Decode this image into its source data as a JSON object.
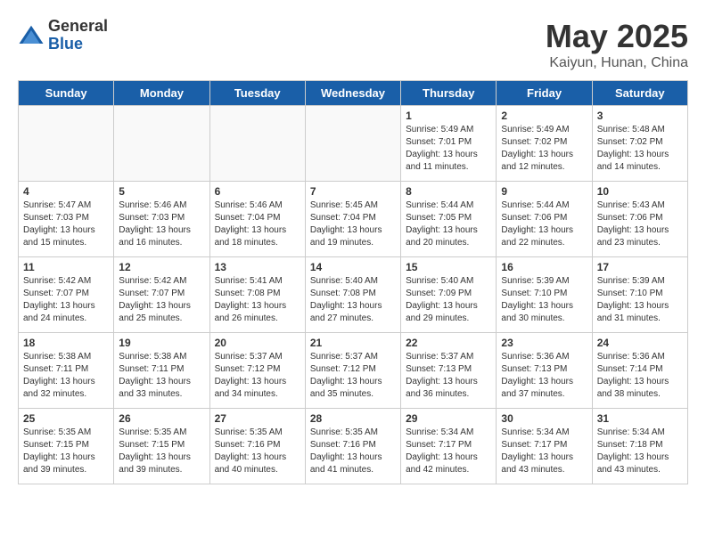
{
  "logo": {
    "general": "General",
    "blue": "Blue"
  },
  "title": "May 2025",
  "subtitle": "Kaiyun, Hunan, China",
  "weekdays": [
    "Sunday",
    "Monday",
    "Tuesday",
    "Wednesday",
    "Thursday",
    "Friday",
    "Saturday"
  ],
  "weeks": [
    [
      {
        "day": "",
        "info": ""
      },
      {
        "day": "",
        "info": ""
      },
      {
        "day": "",
        "info": ""
      },
      {
        "day": "",
        "info": ""
      },
      {
        "day": "1",
        "info": "Sunrise: 5:49 AM\nSunset: 7:01 PM\nDaylight: 13 hours\nand 11 minutes."
      },
      {
        "day": "2",
        "info": "Sunrise: 5:49 AM\nSunset: 7:02 PM\nDaylight: 13 hours\nand 12 minutes."
      },
      {
        "day": "3",
        "info": "Sunrise: 5:48 AM\nSunset: 7:02 PM\nDaylight: 13 hours\nand 14 minutes."
      }
    ],
    [
      {
        "day": "4",
        "info": "Sunrise: 5:47 AM\nSunset: 7:03 PM\nDaylight: 13 hours\nand 15 minutes."
      },
      {
        "day": "5",
        "info": "Sunrise: 5:46 AM\nSunset: 7:03 PM\nDaylight: 13 hours\nand 16 minutes."
      },
      {
        "day": "6",
        "info": "Sunrise: 5:46 AM\nSunset: 7:04 PM\nDaylight: 13 hours\nand 18 minutes."
      },
      {
        "day": "7",
        "info": "Sunrise: 5:45 AM\nSunset: 7:04 PM\nDaylight: 13 hours\nand 19 minutes."
      },
      {
        "day": "8",
        "info": "Sunrise: 5:44 AM\nSunset: 7:05 PM\nDaylight: 13 hours\nand 20 minutes."
      },
      {
        "day": "9",
        "info": "Sunrise: 5:44 AM\nSunset: 7:06 PM\nDaylight: 13 hours\nand 22 minutes."
      },
      {
        "day": "10",
        "info": "Sunrise: 5:43 AM\nSunset: 7:06 PM\nDaylight: 13 hours\nand 23 minutes."
      }
    ],
    [
      {
        "day": "11",
        "info": "Sunrise: 5:42 AM\nSunset: 7:07 PM\nDaylight: 13 hours\nand 24 minutes."
      },
      {
        "day": "12",
        "info": "Sunrise: 5:42 AM\nSunset: 7:07 PM\nDaylight: 13 hours\nand 25 minutes."
      },
      {
        "day": "13",
        "info": "Sunrise: 5:41 AM\nSunset: 7:08 PM\nDaylight: 13 hours\nand 26 minutes."
      },
      {
        "day": "14",
        "info": "Sunrise: 5:40 AM\nSunset: 7:08 PM\nDaylight: 13 hours\nand 27 minutes."
      },
      {
        "day": "15",
        "info": "Sunrise: 5:40 AM\nSunset: 7:09 PM\nDaylight: 13 hours\nand 29 minutes."
      },
      {
        "day": "16",
        "info": "Sunrise: 5:39 AM\nSunset: 7:10 PM\nDaylight: 13 hours\nand 30 minutes."
      },
      {
        "day": "17",
        "info": "Sunrise: 5:39 AM\nSunset: 7:10 PM\nDaylight: 13 hours\nand 31 minutes."
      }
    ],
    [
      {
        "day": "18",
        "info": "Sunrise: 5:38 AM\nSunset: 7:11 PM\nDaylight: 13 hours\nand 32 minutes."
      },
      {
        "day": "19",
        "info": "Sunrise: 5:38 AM\nSunset: 7:11 PM\nDaylight: 13 hours\nand 33 minutes."
      },
      {
        "day": "20",
        "info": "Sunrise: 5:37 AM\nSunset: 7:12 PM\nDaylight: 13 hours\nand 34 minutes."
      },
      {
        "day": "21",
        "info": "Sunrise: 5:37 AM\nSunset: 7:12 PM\nDaylight: 13 hours\nand 35 minutes."
      },
      {
        "day": "22",
        "info": "Sunrise: 5:37 AM\nSunset: 7:13 PM\nDaylight: 13 hours\nand 36 minutes."
      },
      {
        "day": "23",
        "info": "Sunrise: 5:36 AM\nSunset: 7:13 PM\nDaylight: 13 hours\nand 37 minutes."
      },
      {
        "day": "24",
        "info": "Sunrise: 5:36 AM\nSunset: 7:14 PM\nDaylight: 13 hours\nand 38 minutes."
      }
    ],
    [
      {
        "day": "25",
        "info": "Sunrise: 5:35 AM\nSunset: 7:15 PM\nDaylight: 13 hours\nand 39 minutes."
      },
      {
        "day": "26",
        "info": "Sunrise: 5:35 AM\nSunset: 7:15 PM\nDaylight: 13 hours\nand 39 minutes."
      },
      {
        "day": "27",
        "info": "Sunrise: 5:35 AM\nSunset: 7:16 PM\nDaylight: 13 hours\nand 40 minutes."
      },
      {
        "day": "28",
        "info": "Sunrise: 5:35 AM\nSunset: 7:16 PM\nDaylight: 13 hours\nand 41 minutes."
      },
      {
        "day": "29",
        "info": "Sunrise: 5:34 AM\nSunset: 7:17 PM\nDaylight: 13 hours\nand 42 minutes."
      },
      {
        "day": "30",
        "info": "Sunrise: 5:34 AM\nSunset: 7:17 PM\nDaylight: 13 hours\nand 43 minutes."
      },
      {
        "day": "31",
        "info": "Sunrise: 5:34 AM\nSunset: 7:18 PM\nDaylight: 13 hours\nand 43 minutes."
      }
    ]
  ]
}
